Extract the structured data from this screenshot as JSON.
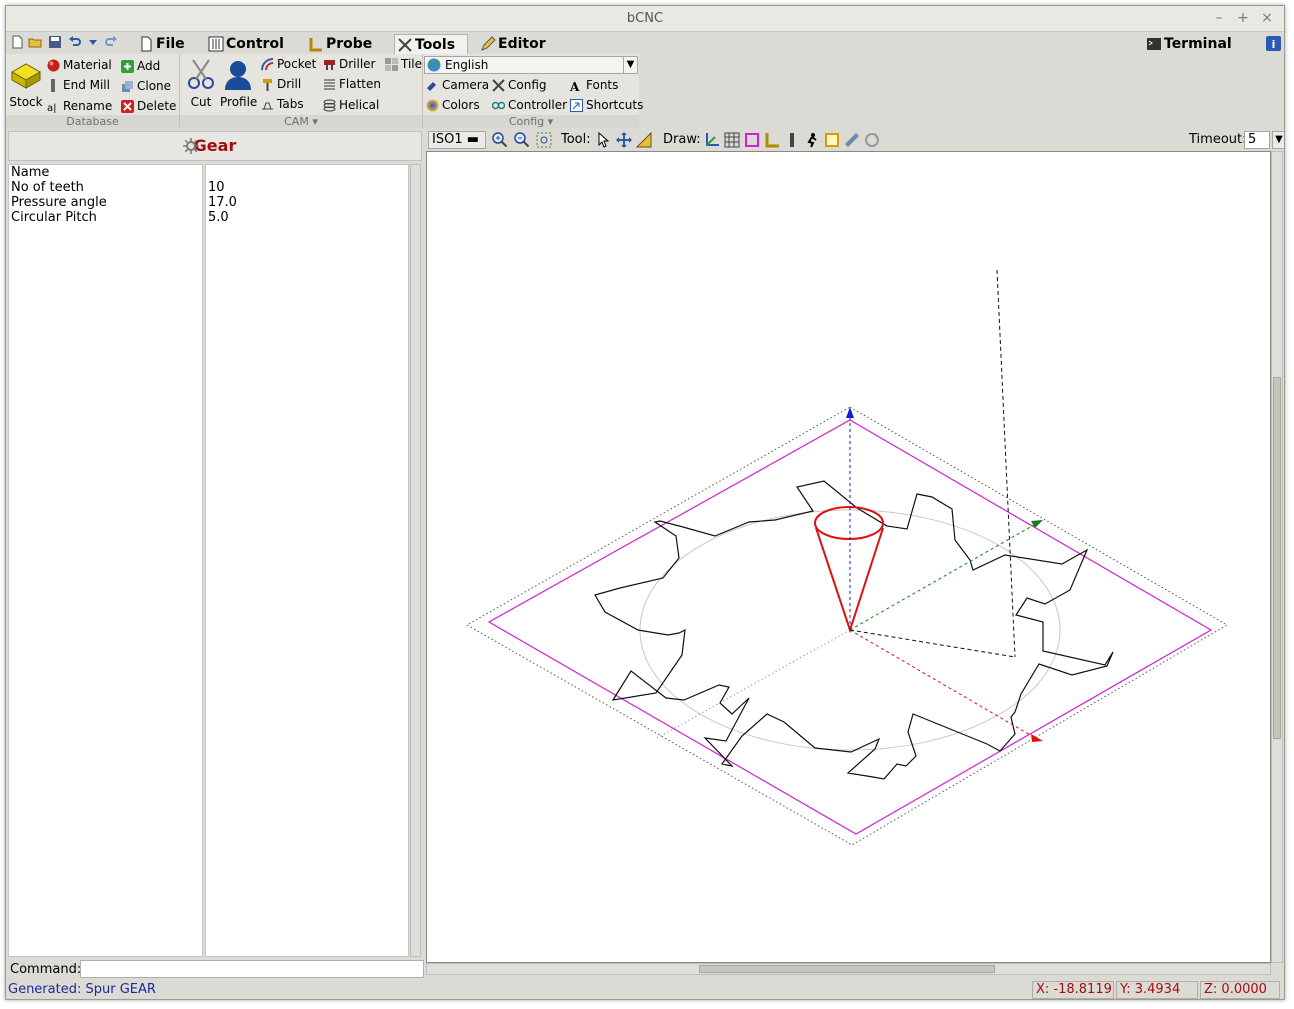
{
  "window": {
    "title": "bCNC"
  },
  "tabs": {
    "file": "File",
    "control": "Control",
    "probe": "Probe",
    "tools": "Tools",
    "editor": "Editor",
    "terminal": "Terminal"
  },
  "ribbon": {
    "database": {
      "label": "Database",
      "stock": "Stock",
      "material": "Material",
      "end_mill": "End Mill",
      "rename": "Rename",
      "add": "Add",
      "clone": "Clone",
      "delete": "Delete"
    },
    "cam": {
      "label": "CAM",
      "cut": "Cut",
      "profile": "Profile",
      "pocket": "Pocket",
      "drill": "Drill",
      "tabs": "Tabs",
      "driller": "Driller",
      "flatten": "Flatten",
      "helical": "Helical",
      "tile": "Tile"
    },
    "config": {
      "label": "Config",
      "language": "English",
      "camera": "Camera",
      "config": "Config",
      "fonts": "Fonts",
      "colors": "Colors",
      "controller": "Controller",
      "shortcuts": "Shortcuts"
    }
  },
  "panel": {
    "title": "Gear",
    "properties": [
      {
        "name": "Name",
        "value": ""
      },
      {
        "name": "No of teeth",
        "value": "10"
      },
      {
        "name": "Pressure angle",
        "value": "17.0"
      },
      {
        "name": "Circular Pitch",
        "value": "5.0"
      }
    ]
  },
  "command": {
    "label": "Command:",
    "value": ""
  },
  "canvas_toolbar": {
    "view": "ISO1",
    "tool_label": "Tool:",
    "draw_label": "Draw:",
    "timeout_label": "Timeout:",
    "timeout_value": "5"
  },
  "status": {
    "message": "Generated: Spur GEAR",
    "x": "X: -18.8119",
    "y": "Y: 3.4934",
    "z": "Z: 0.0000"
  },
  "colors": {
    "accent_red": "#a01010",
    "status_blue": "#1c2a9a",
    "margin_magenta": "#d020d0"
  },
  "icons": [
    "new-file-icon",
    "open-folder-icon",
    "save-icon",
    "undo-icon",
    "redo-icon",
    "zoom-in-icon",
    "zoom-out-icon",
    "zoom-fit-icon",
    "select-icon",
    "pan-icon",
    "ruler-icon",
    "gear-icon",
    "info-icon",
    "globe-icon"
  ]
}
